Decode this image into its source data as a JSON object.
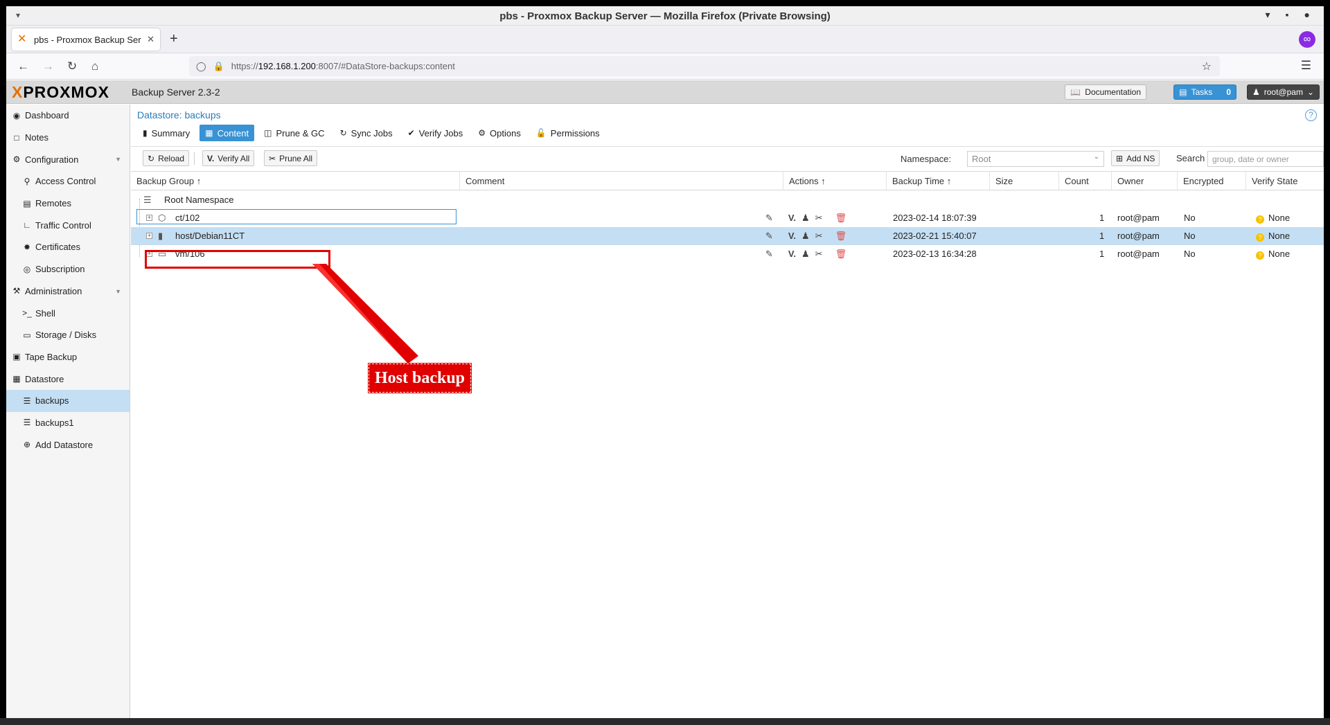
{
  "window": {
    "title": "pbs - Proxmox Backup Server — Mozilla Firefox (Private Browsing)"
  },
  "browser": {
    "tab_title": "pbs - Proxmox Backup Serv",
    "url_prefix": "https://",
    "url_host": "192.168.1.200",
    "url_rest": ":8007/#DataStore-backups:content"
  },
  "app": {
    "logo_x": "X",
    "logo_text": "PROXMOX",
    "product": "Backup Server 2.3-2",
    "documentation": "Documentation",
    "tasks_label": "Tasks",
    "tasks_count": "0",
    "user": "root@pam"
  },
  "sidebar": {
    "items": [
      {
        "label": "Dashboard"
      },
      {
        "label": "Notes"
      },
      {
        "label": "Configuration"
      },
      {
        "label": "Access Control"
      },
      {
        "label": "Remotes"
      },
      {
        "label": "Traffic Control"
      },
      {
        "label": "Certificates"
      },
      {
        "label": "Subscription"
      },
      {
        "label": "Administration"
      },
      {
        "label": "Shell"
      },
      {
        "label": "Storage / Disks"
      },
      {
        "label": "Tape Backup"
      },
      {
        "label": "Datastore"
      },
      {
        "label": "backups"
      },
      {
        "label": "backups1"
      },
      {
        "label": "Add Datastore"
      }
    ]
  },
  "main": {
    "breadcrumb": "Datastore: backups",
    "tabs": [
      {
        "label": "Summary"
      },
      {
        "label": "Content"
      },
      {
        "label": "Prune & GC"
      },
      {
        "label": "Sync Jobs"
      },
      {
        "label": "Verify Jobs"
      },
      {
        "label": "Options"
      },
      {
        "label": "Permissions"
      }
    ],
    "toolbar": {
      "reload": "Reload",
      "verify_all": "Verify All",
      "prune_all": "Prune All",
      "namespace_label": "Namespace:",
      "namespace_value": "Root",
      "add_ns": "Add NS",
      "search_label": "Search",
      "search_placeholder": "group, date or owner"
    },
    "columns": {
      "backup_group": "Backup Group ↑",
      "comment": "Comment",
      "actions": "Actions ↑",
      "backup_time": "Backup Time ↑",
      "size": "Size",
      "count": "Count",
      "owner": "Owner",
      "encrypted": "Encrypted",
      "verify_state": "Verify State"
    },
    "root_namespace": "Root Namespace",
    "rows": [
      {
        "group": "ct/102",
        "time": "2023-02-14 18:07:39",
        "count": "1",
        "owner": "root@pam",
        "encrypted": "No",
        "verify": "None"
      },
      {
        "group": "host/Debian11CT",
        "time": "2023-02-21 15:40:07",
        "count": "1",
        "owner": "root@pam",
        "encrypted": "No",
        "verify": "None"
      },
      {
        "group": "vm/106",
        "time": "2023-02-13 16:34:28",
        "count": "1",
        "owner": "root@pam",
        "encrypted": "No",
        "verify": "None"
      }
    ]
  },
  "annotation": {
    "label": "Host backup",
    "color": "#e00000"
  },
  "colors": {
    "accent": "#3892d4",
    "selection": "#c4dff3",
    "brand_orange": "#e57000"
  }
}
